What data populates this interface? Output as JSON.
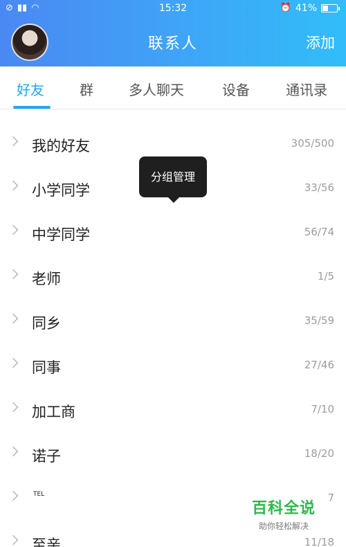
{
  "status_bar": {
    "time": "15:32",
    "battery": "41%",
    "battery_level": 0.41,
    "icons_left": [
      "no-sim-icon",
      "signal-icon",
      "wifi-icon"
    ],
    "icons_right": [
      "alarm-icon",
      "battery-icon"
    ]
  },
  "header": {
    "title": "联系人",
    "add_label": "添加"
  },
  "tabs": [
    {
      "label": "好友",
      "active": true
    },
    {
      "label": "群"
    },
    {
      "label": "多人聊天"
    },
    {
      "label": "设备"
    },
    {
      "label": "通讯录"
    }
  ],
  "tooltip": {
    "label": "分组管理"
  },
  "groups": [
    {
      "name": "我的好友",
      "count": "305/500"
    },
    {
      "name": "小学同学",
      "count": "33/56"
    },
    {
      "name": "中学同学",
      "count": "56/74"
    },
    {
      "name": "老师",
      "count": "1/5"
    },
    {
      "name": "同乡",
      "count": "35/59"
    },
    {
      "name": "同事",
      "count": "27/46"
    },
    {
      "name": "加工商",
      "count": "7/10"
    },
    {
      "name": "诺子",
      "count": "18/20"
    },
    {
      "name": "TEL",
      "count": "7"
    },
    {
      "name": "至亲",
      "count": "11/18"
    }
  ],
  "watermark": {
    "title": "百科全说",
    "subtitle": "助你轻松解决"
  },
  "colors": {
    "accent": "#22a7ea",
    "header_start": "#4a88f3",
    "header_end": "#31bdf9"
  }
}
